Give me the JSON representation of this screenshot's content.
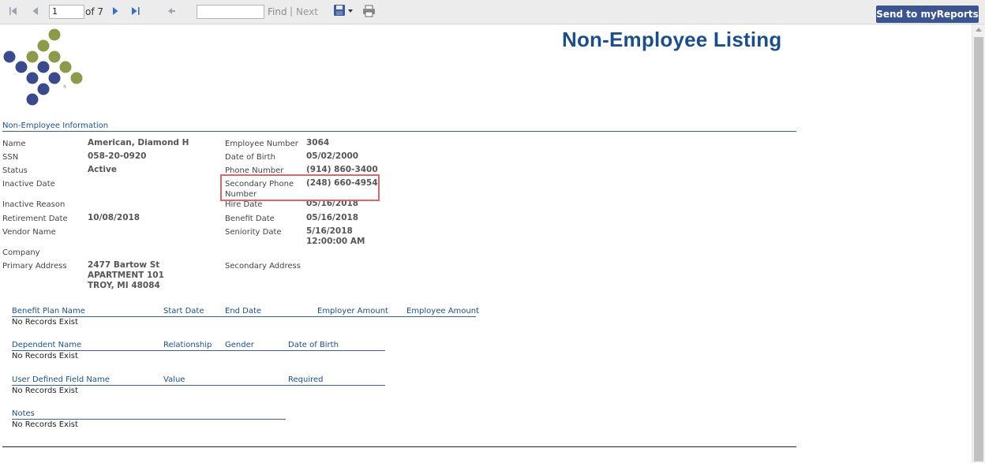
{
  "toolbar": {
    "page_value": "1",
    "of_text": "of 7",
    "find_label": "Find",
    "separator": "|",
    "next_label": "Next",
    "send_label": "Send to myReports"
  },
  "report": {
    "title": "Non-Employee Listing",
    "section_title": "Non-Employee Information",
    "left_fields": [
      {
        "label": "Name",
        "value": "American, Diamond H"
      },
      {
        "label": "SSN",
        "value": "058-20-0920"
      },
      {
        "label": "Status",
        "value": "Active"
      },
      {
        "label": "Inactive Date",
        "value": ""
      },
      {
        "label": "Inactive Reason",
        "value": ""
      },
      {
        "label": "Retirement Date",
        "value": "10/08/2018"
      },
      {
        "label": "Vendor Name",
        "value": ""
      },
      {
        "label": "Company",
        "value": ""
      },
      {
        "label": "Primary Address",
        "value_lines": [
          "2477 Bartow St",
          "APARTMENT 101",
          "TROY, MI 48084"
        ]
      }
    ],
    "right_fields": [
      {
        "label": "Employee Number",
        "value": "3064"
      },
      {
        "label": "Date of Birth",
        "value": "05/02/2000"
      },
      {
        "label": "Phone Number",
        "value": "(914) 860-3400"
      },
      {
        "label_lines": [
          "Secondary Phone",
          "Number"
        ],
        "value": "(248) 660-4954"
      },
      {
        "label": "Hire Date",
        "value": "05/16/2018"
      },
      {
        "label": "Benefit Date",
        "value": "05/16/2018"
      },
      {
        "label": "Seniority Date",
        "value_lines": [
          "5/16/2018",
          "12:00:00 AM"
        ]
      },
      {
        "label": "Secondary Address",
        "value": ""
      }
    ],
    "benefits": {
      "headers": [
        "Benefit Plan Name",
        "Start Date",
        "End Date",
        "Employer Amount",
        "Employee Amount"
      ],
      "empty": "No Records Exist"
    },
    "dependents": {
      "headers": [
        "Dependent Name",
        "Relationship",
        "Gender",
        "Date of Birth"
      ],
      "empty": "No Records Exist"
    },
    "udf": {
      "headers": [
        "User Defined Field Name",
        "Value",
        "Required"
      ],
      "empty": "No Records Exist"
    },
    "notes": {
      "headers": [
        "Notes"
      ],
      "empty": "No Records Exist"
    }
  },
  "colors": {
    "accent": "#1c4f8a",
    "button": "#3b5590",
    "logo_blue": "#3b4a8c",
    "logo_olive": "#8c9a4a",
    "highlight": "#e06666"
  }
}
